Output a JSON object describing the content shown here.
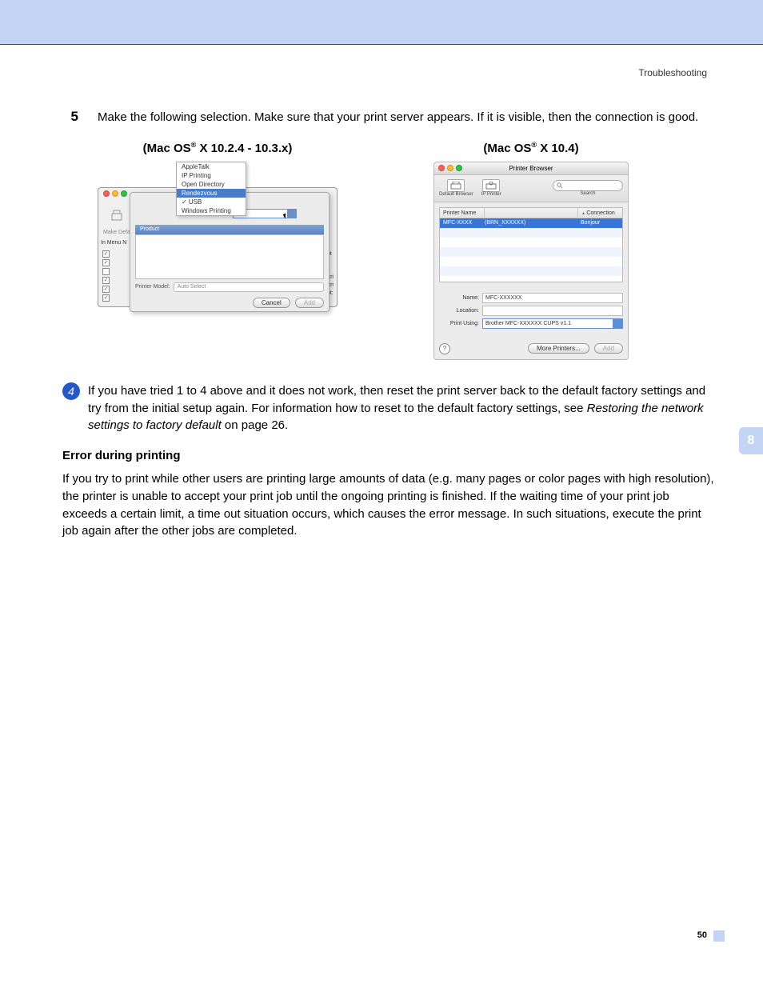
{
  "header": {
    "section": "Troubleshooting"
  },
  "step5": {
    "num": "5",
    "text": "Make the following selection. Make sure that your print server appears. If it is visible, then the connection is good."
  },
  "shot1": {
    "caption_pre": "(Mac OS",
    "caption_post": " X 10.2.4 - 10.3.x)",
    "menu": {
      "appletalk": "AppleTalk",
      "ipprinting": "IP Printing",
      "opendir": "Open Directory",
      "rendezvous": "Rendezvous",
      "usb": "✓ USB",
      "winprint": "Windows Printing"
    },
    "back": {
      "make_default": "Make Defa",
      "in_menu": "In Menu  N",
      "right_lines": "R-Script\n\ninter\ni BR-Scri\ni BR-Scri\nR-Script:"
    },
    "dialog": {
      "product_bar": "Product",
      "printer_model": "Printer Model:",
      "auto_select": "Auto Select",
      "cancel": "Cancel",
      "add": "Add"
    }
  },
  "shot2": {
    "caption_pre": "(Mac OS",
    "caption_post": " X 10.4)",
    "title": "Printer Browser",
    "toolbar": {
      "default_browser": "Default Browser",
      "ip_printer": "IP Printer",
      "search": "Search"
    },
    "list": {
      "col_name": "Printer Name",
      "col_conn": "Connection",
      "row_name": "MFC-XXXX",
      "row_sub": "(BRN_XXXXXX)",
      "row_conn": "Bonjour"
    },
    "form": {
      "name_label": "Name:",
      "name_value": "MFC-XXXXXX",
      "location_label": "Location:",
      "location_value": "",
      "printusing_label": "Print Using:",
      "printusing_value": "Brother MFC-XXXXXX CUPS v1.1"
    },
    "footer": {
      "more": "More Printers...",
      "add": "Add"
    }
  },
  "step4b": {
    "num": "4",
    "text_a": "If you have tried 1 to 4 above and it does not work, then reset the print server back to the default factory settings and try from the initial setup again. For information how to reset to the default factory settings, see ",
    "text_ital": "Restoring the network settings to factory default",
    "text_b": " on page 26."
  },
  "error_section": {
    "heading": "Error during printing",
    "para": "If you try to print while other users are printing large amounts of data (e.g. many pages or color pages with high resolution), the printer is unable to accept your print job until the ongoing printing is finished. If the waiting time of your print job exceeds a certain limit, a time out situation occurs, which causes the error message. In such situations, execute the print job again after the other jobs are completed."
  },
  "side": {
    "chapter": "8"
  },
  "page": {
    "num": "50"
  }
}
